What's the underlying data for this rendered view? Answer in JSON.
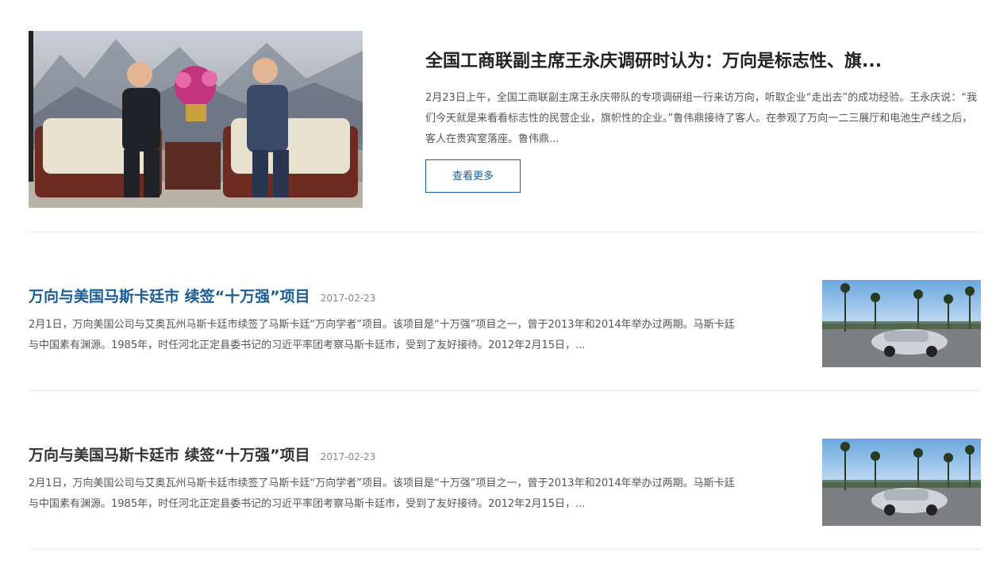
{
  "featured": {
    "title": "全国工商联副主席王永庆调研时认为：万向是标志性、旗...",
    "description": "2月23日上午，全国工商联副主席王永庆带队的专项调研组一行来访万向，听取企业“走出去”的成功经验。王永庆说：“我们今天就是来看看标志性的民营企业，旗帜性的企业。”鲁伟鼎接待了客人。在参观了万向一二三展厅和电池生产线之后，客人在贵宾室落座。鲁伟鼎...",
    "more_label": "查看更多"
  },
  "news": [
    {
      "title": "万向与美国马斯卡廷市 续签“十万强”项目",
      "date": "2017-02-23",
      "description": "2月1日，万向美国公司与艾奥瓦州马斯卡廷市续签了马斯卡廷“万向学者”项目。该项目是“十万强”项目之一，曾于2013年和2014年举办过两期。马斯卡廷与中国素有渊源。1985年，时任河北正定县委书记的习近平率团考察马斯卡廷市，受到了友好接待。2012年2月15日，..."
    },
    {
      "title": "万向与美国马斯卡廷市 续签“十万强”项目",
      "date": "2017-02-23",
      "description": "2月1日，万向美国公司与艾奥瓦州马斯卡廷市续签了马斯卡廷“万向学者”项目。该项目是“十万强”项目之一，曾于2013年和2014年举办过两期。马斯卡廷与中国素有渊源。1985年，时任河北正定县委书记的习近平率团考察马斯卡廷市，受到了友好接待。2012年2月15日，..."
    }
  ],
  "colors": {
    "accent": "#1b5c94",
    "divider": "#e8e8e8"
  }
}
